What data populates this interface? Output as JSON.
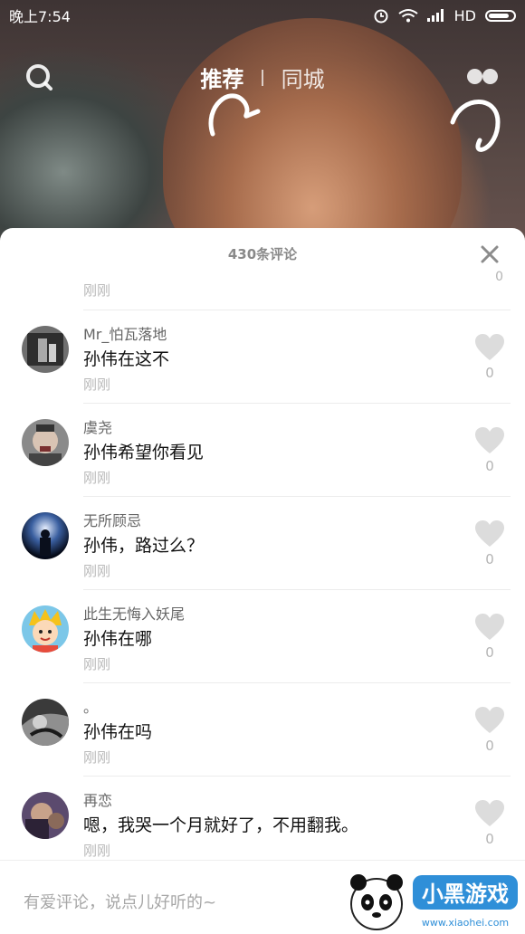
{
  "status_bar": {
    "time": "晚上7:54",
    "network": "HD"
  },
  "nav": {
    "tab_recommend": "推荐",
    "tab_local": "同城"
  },
  "sheet": {
    "title": "430条评论"
  },
  "partial": {
    "timestamp": "刚刚",
    "likes": "0"
  },
  "comments": [
    {
      "username": "Mr_怕瓦落地",
      "text": "孙伟在这不",
      "timestamp": "刚刚",
      "likes": "0"
    },
    {
      "username": "虞尧",
      "text": "孙伟希望你看见",
      "timestamp": "刚刚",
      "likes": "0"
    },
    {
      "username": "无所顾忌",
      "text": "孙伟，路过么？",
      "timestamp": "刚刚",
      "likes": "0"
    },
    {
      "username": "此生无悔入妖尾",
      "text": "孙伟在哪",
      "timestamp": "刚刚",
      "likes": "0"
    },
    {
      "username": "。",
      "text": "孙伟在吗",
      "timestamp": "刚刚",
      "likes": "0"
    },
    {
      "username": "再恋",
      "text": "嗯，我哭一个月就好了，不用翻我。",
      "timestamp": "刚刚",
      "likes": "0"
    }
  ],
  "input": {
    "placeholder": "有爱评论，说点儿好听的~"
  },
  "watermark": {
    "brand": "小黑游戏",
    "url": "www.xiaohei.com"
  },
  "colors": {
    "sheet_bg": "#ffffff",
    "muted_text": "#b9b9b9",
    "like_icon": "#dcdcdc",
    "watermark_blue": "#2f8fd8"
  }
}
